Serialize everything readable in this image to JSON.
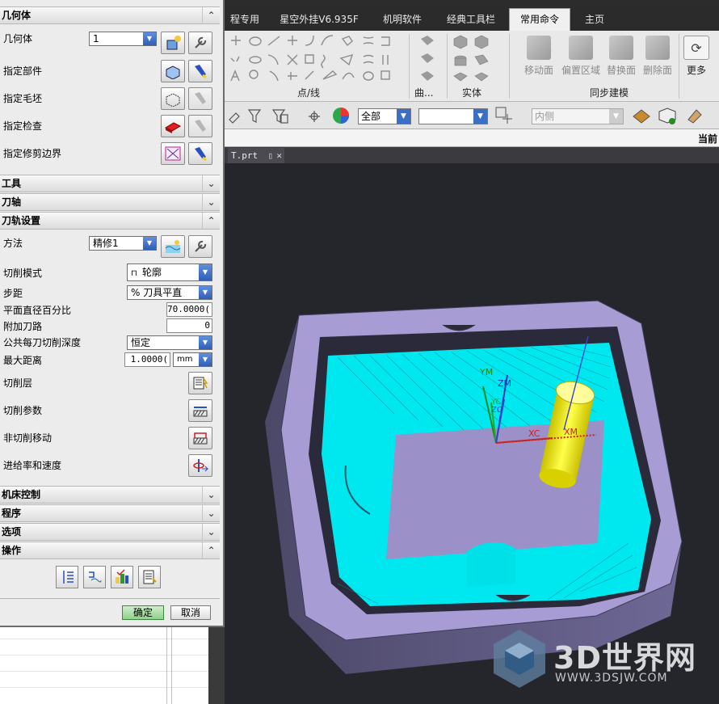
{
  "ribbon": {
    "tabs": [
      "程专用",
      "星空外挂V6.935F",
      "机明软件",
      "经典工具栏",
      "常用命令",
      "主页"
    ],
    "active_tab": "常用命令",
    "groups": {
      "points_lines": "点/线",
      "curve": "曲...",
      "solid": "实体",
      "sync_modeling": "同步建模"
    },
    "sync_buttons": [
      "移动面",
      "偏置区域",
      "替换面",
      "删除面"
    ],
    "more_label": "更多"
  },
  "selection_bar": {
    "filter_value": "全部",
    "second_value": "",
    "inside_value": "内侧"
  },
  "right_edge_text": "当前",
  "file_tab": {
    "name": "T.prt"
  },
  "dialog": {
    "sections": {
      "geometry": "几何体",
      "tool": "工具",
      "tool_axis": "刀轴",
      "path_settings": "刀轨设置",
      "machine_control": "机床控制",
      "program": "程序",
      "options": "选项",
      "actions": "操作"
    },
    "geometry": {
      "label": "几何体",
      "value": "1",
      "specify_part": "指定部件",
      "specify_blank": "指定毛坯",
      "specify_check": "指定检查",
      "specify_trim": "指定修剪边界"
    },
    "path": {
      "method_label": "方法",
      "method_value": "精修1",
      "cut_pattern_label": "切削模式",
      "cut_pattern_value": "轮廓",
      "stepover_label": "步距",
      "stepover_value": "% 刀具平直",
      "flat_pct_label": "平面直径百分比",
      "flat_pct_value": "70.0000(",
      "extra_passes_label": "附加刀路",
      "extra_passes_value": "0",
      "depth_label": "公共每刀切削深度",
      "depth_value": "恒定",
      "max_dist_label": "最大距离",
      "max_dist_value": "1.0000(",
      "max_dist_unit": "mm",
      "cut_levels": "切削层",
      "cut_params": "切削参数",
      "non_cut_moves": "非切削移动",
      "feeds_speeds": "进给率和速度"
    },
    "ok": "确定",
    "cancel": "取消"
  },
  "viewport": {
    "axes": {
      "ym": "YM",
      "zm": "ZM",
      "yc": "YC",
      "zc": "ZC",
      "xc": "XC",
      "xm": "XM"
    },
    "colors": {
      "part": "#a79cd4",
      "toolpath": "#00ffff",
      "tool": "#ffff33",
      "background": "#24262b"
    }
  },
  "watermark": {
    "title": "3D世界网",
    "url": "WWW.3DSJW.COM"
  }
}
